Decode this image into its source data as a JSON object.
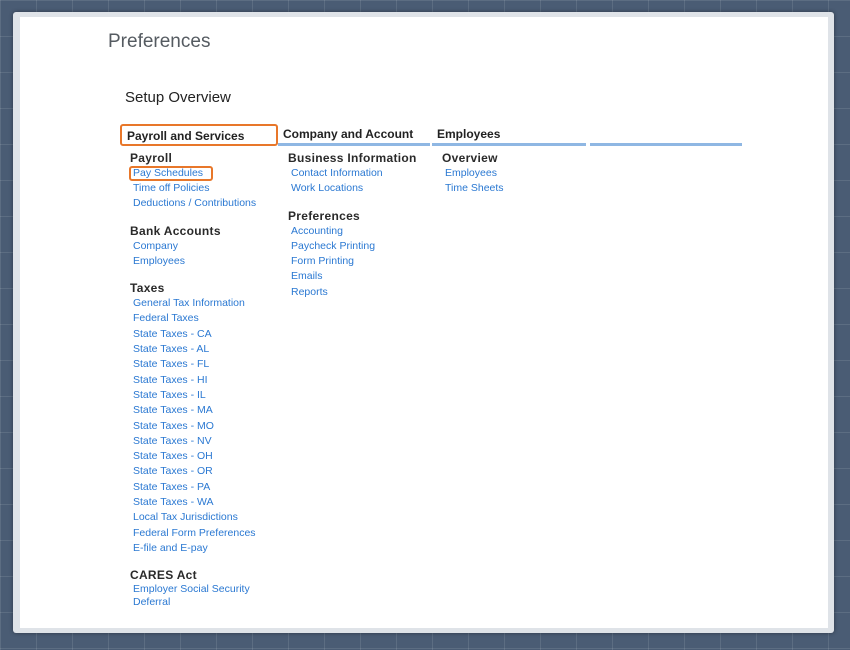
{
  "page_title": "Preferences",
  "section_title": "Setup Overview",
  "columns": [
    {
      "header": "Payroll and Services",
      "groups": [
        {
          "title": "Payroll",
          "links": [
            "Pay Schedules",
            "Time off Policies",
            "Deductions / Contributions"
          ]
        },
        {
          "title": "Bank Accounts",
          "links": [
            "Company",
            "Employees"
          ]
        },
        {
          "title": "Taxes",
          "links": [
            "General Tax Information",
            "Federal Taxes",
            "State Taxes - CA",
            "State Taxes - AL",
            "State Taxes - FL",
            "State Taxes - HI",
            "State Taxes - IL",
            "State Taxes - MA",
            "State Taxes - MO",
            "State Taxes - NV",
            "State Taxes - OH",
            "State Taxes - OR",
            "State Taxes - PA",
            "State Taxes - WA",
            "Local Tax Jurisdictions",
            "Federal Form Preferences",
            "E-file and E-pay"
          ]
        },
        {
          "title": "CARES Act",
          "links": [
            "Employer Social Security Deferral"
          ]
        }
      ]
    },
    {
      "header": "Company and Account",
      "groups": [
        {
          "title": "Business Information",
          "links": [
            "Contact Information",
            "Work Locations"
          ]
        },
        {
          "title": "Preferences",
          "links": [
            "Accounting",
            "Paycheck Printing",
            "Form Printing",
            "Emails",
            "Reports"
          ]
        }
      ]
    },
    {
      "header": "Employees",
      "groups": [
        {
          "title": "Overview",
          "links": [
            "Employees",
            "Time Sheets"
          ]
        }
      ]
    }
  ],
  "colors": {
    "link": "#2a78d2",
    "underline": "#8fb7e3",
    "highlight": "#e8772a"
  }
}
